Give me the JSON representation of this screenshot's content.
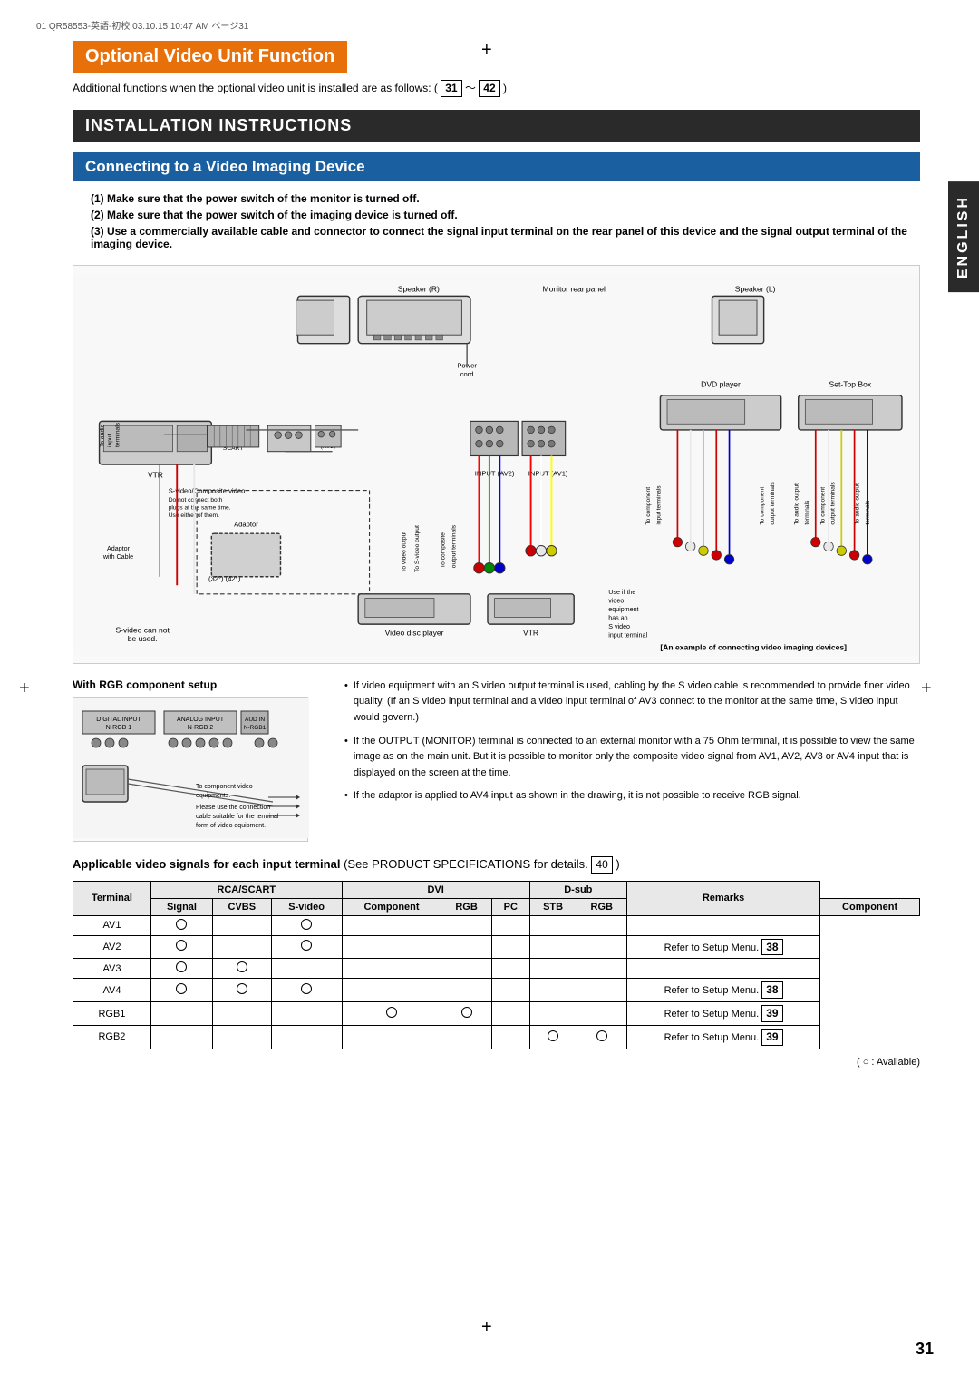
{
  "header": {
    "meta_text": "01 QR58553-英語-初校  03.10.15  10:47 AM  ページ31"
  },
  "page": {
    "number": "31",
    "side_tab": "ENGLISH"
  },
  "section_optional": {
    "title": "Optional Video Unit Function",
    "additional_text": "Additional functions when the optional video unit is installed are as follows: ( 31 ～ 42 )"
  },
  "section_installation": {
    "title": "INSTALLATION INSTRUCTIONS"
  },
  "section_connecting": {
    "title": "Connecting to a Video Imaging Device"
  },
  "instructions": [
    "(1) Make sure that the power switch of the monitor is turned off.",
    "(2) Make sure that the power switch of the imaging device is turned off.",
    "(3) Use a commercially available cable and connector to connect the signal input terminal on the rear panel of this device and the signal output terminal of the imaging device."
  ],
  "diagram": {
    "caption": "[An example of connecting video imaging devices]",
    "labels": {
      "speaker_r": "Speaker (R)",
      "speaker_l": "Speaker (L)",
      "monitor_rear": "Monitor rear panel",
      "vtr": "VTR",
      "s_video": "S-video/Composite video",
      "do_not_connect": "Do not connect both plugs at the same time. Use either of them.",
      "adaptor": "Adaptor",
      "adaptor_with_cable": "Adaptor with Cable",
      "dvd_player": "DVD player",
      "set_top_box": "Set-Top Box",
      "video_disc_player": "Video disc player",
      "vtr2": "VTR",
      "use_if": "Use if the video equipment has an S video input terminal",
      "s_video_cannot": "S-video can not be used.",
      "input_av4_scart": "INPUT (AV4) SCART",
      "output_monitor": "OUTPUT (MONITOR)",
      "input_av3": "INPUT (AV3)",
      "input_av2": "INPUT (AV2)",
      "input_av1": "INPUT (AV1)",
      "size_32": "(32°)",
      "size_42": "(42°)"
    }
  },
  "rgb_section": {
    "title": "With RGB component setup",
    "labels": {
      "to_component": "To component video equipments.",
      "use_connection": "Please use the connection cable suitable for the terminal form of video equipment."
    }
  },
  "bullet_points": [
    "If video equipment with an S video output terminal is used, cabling by the S video cable is recommended to provide finer video quality. (If an S video input terminal and a video input terminal of AV3 connect to the monitor at the same time, S video input would govern.)",
    "If the OUTPUT (MONITOR) terminal is connected to an external monitor with a 75 Ohm terminal, it is possible to view the same image as on the main unit. But it is possible to monitor only the composite video signal from AV1, AV2, AV3 or AV4 input that is displayed on the screen at the time.",
    "If the adaptor is applied to AV4 input as shown in the drawing, it is not possible to receive RGB signal."
  ],
  "applicable_section": {
    "title_prefix": "Applicable video signals for each input terminal",
    "title_suffix": "(See PRODUCT SPECIFICATIONS for details.",
    "box_num": "40",
    "close_paren": ")"
  },
  "signal_table": {
    "headers": {
      "terminal": "Terminal",
      "rca_scart": "RCA/SCART",
      "dvi": "DVI",
      "d_sub": "D-sub",
      "remarks": "Remarks"
    },
    "sub_headers": {
      "signal": "Signal",
      "cvbs": "CVBS",
      "s_video": "S-video",
      "component": "Component",
      "rgb": "RGB",
      "pc": "PC",
      "stb": "STB",
      "rgb2": "RGB",
      "component2": "Component"
    },
    "rows": [
      {
        "terminal": "AV1",
        "cvbs": true,
        "s_video": false,
        "component": true,
        "dvi_rgb": false,
        "dvi_pc": false,
        "dvi_stb": false,
        "dsub_rgb": false,
        "dsub_component": false,
        "remarks": ""
      },
      {
        "terminal": "AV2",
        "cvbs": true,
        "s_video": false,
        "component": true,
        "dvi_rgb": false,
        "dvi_pc": false,
        "dvi_stb": false,
        "dsub_rgb": false,
        "dsub_component": false,
        "remarks": "Refer to Setup Menu. 38"
      },
      {
        "terminal": "AV3",
        "cvbs": true,
        "s_video": true,
        "component": false,
        "dvi_rgb": false,
        "dvi_pc": false,
        "dvi_stb": false,
        "dsub_rgb": false,
        "dsub_component": false,
        "remarks": ""
      },
      {
        "terminal": "AV4",
        "cvbs": true,
        "s_video": true,
        "component": true,
        "dvi_rgb": false,
        "dvi_pc": false,
        "dvi_stb": false,
        "dsub_rgb": false,
        "dsub_component": false,
        "remarks": "Refer to Setup Menu. 38"
      },
      {
        "terminal": "RGB1",
        "cvbs": false,
        "s_video": false,
        "component": false,
        "dvi_rgb": true,
        "dvi_pc": true,
        "dvi_stb": false,
        "dsub_rgb": false,
        "dsub_component": false,
        "remarks": "Refer to Setup Menu. 39"
      },
      {
        "terminal": "RGB2",
        "cvbs": false,
        "s_video": false,
        "component": false,
        "dvi_rgb": false,
        "dvi_pc": false,
        "dvi_stb": false,
        "dsub_rgb": true,
        "dsub_component": true,
        "remarks": "Refer to Setup Menu. 39"
      }
    ]
  },
  "note_available": "( ○ : Available)"
}
